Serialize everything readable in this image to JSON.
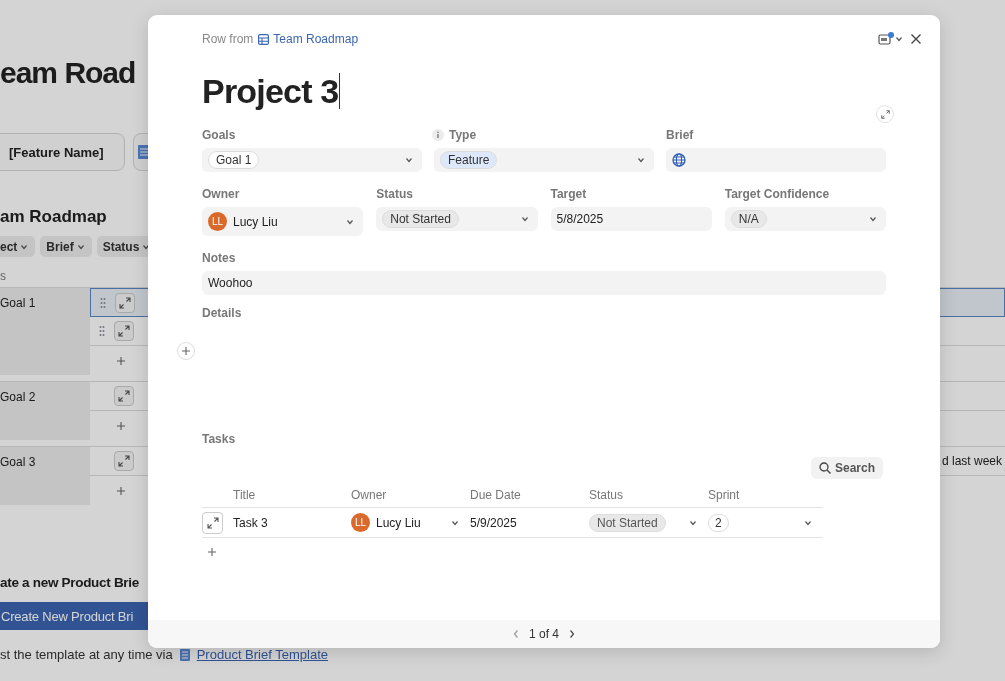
{
  "background": {
    "page_title": "eam Road",
    "buttons": [
      {
        "kind": "text",
        "label": "[Feature Name]"
      },
      {
        "kind": "doc"
      }
    ],
    "section_title": "am Roadmap",
    "filters": [
      "ect",
      "Brief",
      "Status"
    ],
    "columns": [
      "s"
    ],
    "groups": [
      {
        "goal": "Goal 1",
        "rows": [
          {
            "selected": true,
            "handle": true
          },
          {
            "selected": false,
            "handle": true
          }
        ]
      },
      {
        "goal": "Goal 2",
        "rows": [
          {
            "selected": false,
            "handle": false
          }
        ]
      },
      {
        "goal": "Goal 3",
        "rows": [
          {
            "selected": false,
            "handle": false,
            "trailing": "d last week"
          }
        ]
      }
    ],
    "cta_title": "ate a new Product Brie",
    "cta_button": "Create New Product Bri",
    "footnote": "st the template at any time via",
    "footnote_link": "Product Brief Template"
  },
  "dialog": {
    "breadcrumb": "Row from",
    "source": "Team Roadmap",
    "title": "Project 3",
    "fields_top": [
      {
        "label": "Goals",
        "kind": "chips",
        "chip": "Goal 1",
        "color": "#ffffff",
        "info": false
      },
      {
        "label": "Type",
        "kind": "chips",
        "chip": "Feature",
        "color": "#dde9fb",
        "info": true
      },
      {
        "label": "Brief",
        "kind": "url",
        "info": false
      }
    ],
    "fields_mid": [
      {
        "label": "Owner",
        "kind": "person",
        "avatar": "LL",
        "value": "Lucy Liu",
        "info": false
      },
      {
        "label": "Status",
        "kind": "chips",
        "chip": "Not Started",
        "color": "#e8e8e8",
        "info": false
      },
      {
        "label": "Target",
        "kind": "text",
        "value": "5/8/2025",
        "info": false
      },
      {
        "label": "Target Confidence",
        "kind": "chips",
        "chip": "N/A",
        "color": "#e8e8e8",
        "info": false
      }
    ],
    "notes": {
      "label": "Notes",
      "value": "Woohoo"
    },
    "details": {
      "label": "Details"
    },
    "tasks": {
      "label": "Tasks",
      "search": "Search",
      "columns": [
        "Title",
        "Owner",
        "Due Date",
        "Status",
        "Sprint"
      ],
      "rows": [
        {
          "title": "Task 3",
          "avatar": "LL",
          "owner": "Lucy Liu",
          "due": "5/9/2025",
          "status": "Not Started",
          "sprint": "2"
        }
      ]
    },
    "pager": "1 of 4"
  }
}
